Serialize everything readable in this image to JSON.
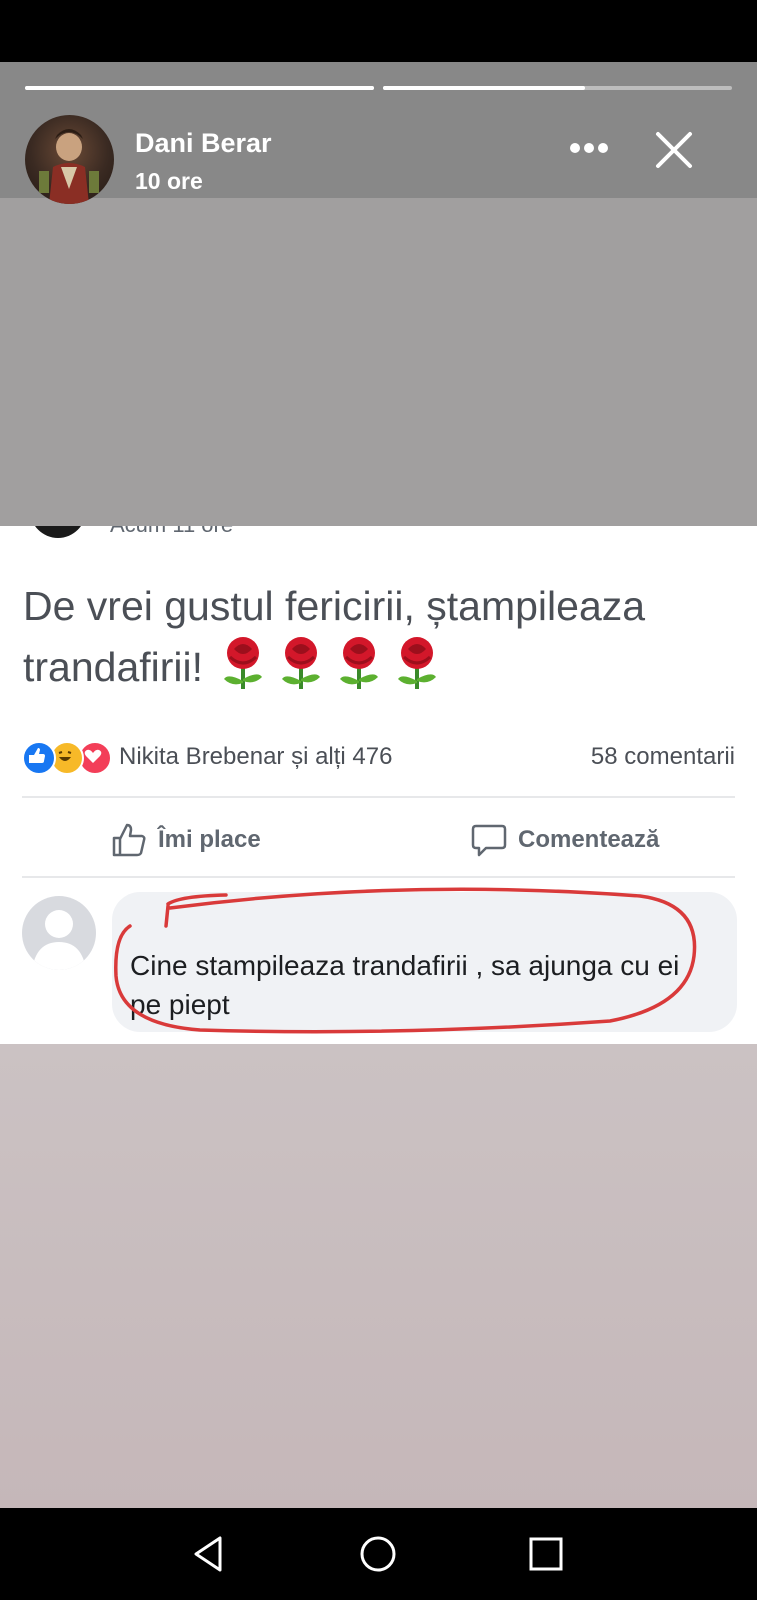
{
  "story": {
    "author_name": "Dani Berar",
    "time": "10 ore",
    "progress": [
      1.0,
      0.58
    ]
  },
  "post": {
    "cut_header_text": "Acum 11 ore",
    "text": "De vrei gustul fericirii, ștampileaza trandafirii!",
    "rose_count": 4,
    "reactions_text": "Nikita Brebenar și alți 476",
    "comments_count": "58 comentarii",
    "like_label": "Îmi place",
    "comment_label": "Comentează"
  },
  "comment": {
    "text": "Cine stampileaza trandafirii , sa ajunga cu ei pe piept"
  },
  "colors": {
    "like_blue": "#1877f2",
    "haha_yellow": "#f7b928",
    "love_red": "#f33e58",
    "annotation_red": "#d93a3a"
  },
  "icons": [
    "more-icon",
    "close-icon",
    "like-icon",
    "comment-icon",
    "rose-emoji",
    "back-icon",
    "home-icon",
    "recents-icon"
  ]
}
